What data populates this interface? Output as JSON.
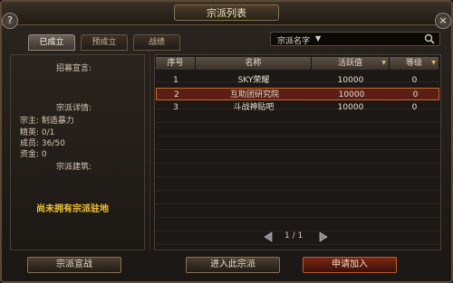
{
  "window": {
    "title": "宗派列表",
    "help_icon": "?",
    "close_icon": "×"
  },
  "tabs": [
    {
      "label": "已成立",
      "active": true
    },
    {
      "label": "预成立",
      "active": false
    },
    {
      "label": "战绩",
      "active": false
    }
  ],
  "search": {
    "dropdown_label": "宗派名字",
    "dropdown_caret": "▼",
    "value": ""
  },
  "left_panel": {
    "recruit_label": "招募宣言:",
    "details_label": "宗派详情:",
    "leader": "宗主: 制造暴力",
    "elite": "精英: 0/1",
    "members": "成员: 36/50",
    "funds": "资金: 0",
    "buildings_label": "宗派建筑:",
    "notice": "尚未拥有宗派驻地"
  },
  "table": {
    "headers": [
      "序号",
      "名称",
      "活跃值",
      "等级"
    ],
    "sort_icon": "▼",
    "rows": [
      {
        "index": "1",
        "name": "SKY荣耀",
        "activity": "10000",
        "level": "0",
        "selected": false
      },
      {
        "index": "2",
        "name": "互助团研究院",
        "activity": "10000",
        "level": "0",
        "selected": true
      },
      {
        "index": "3",
        "name": "斗战神贴吧",
        "activity": "10000",
        "level": "0",
        "selected": false
      }
    ]
  },
  "pager": {
    "text": "1 / 1"
  },
  "buttons": {
    "declare_war": "宗派宣战",
    "enter": "进入此宗派",
    "apply": "申请加入"
  },
  "colors": {
    "selected_row": "#5a1e14",
    "notice": "#f0c238",
    "apply_button": "#7a2818"
  }
}
